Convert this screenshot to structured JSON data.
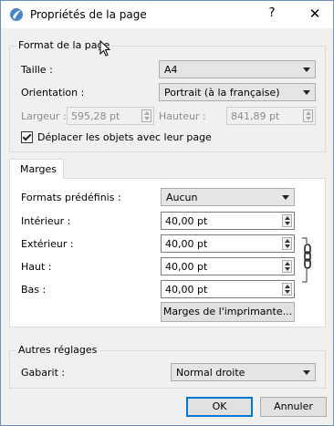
{
  "window": {
    "title": "Propriétés de la page",
    "help_label": "?",
    "close_label": "✕"
  },
  "page_format": {
    "group_title": "Format de la page",
    "size_label": "Taille :",
    "size_value": "A4",
    "orientation_label": "Orientation :",
    "orientation_value": "Portrait (à la française)",
    "width_label": "Largeur :",
    "width_value": "595,28 pt",
    "height_label": "Hauteur :",
    "height_value": "841,89 pt",
    "move_objects_label": "Déplacer les objets avec leur page",
    "move_objects_checked": true
  },
  "margins": {
    "tab_label": "Marges",
    "presets_label": "Formats prédéfinis :",
    "presets_value": "Aucun",
    "inside_label": "Intérieur :",
    "inside_value": "40,00 pt",
    "outside_label": "Extérieur :",
    "outside_value": "40,00 pt",
    "top_label": "Haut :",
    "top_value": "40,00 pt",
    "bottom_label": "Bas :",
    "bottom_value": "40,00 pt",
    "printer_margins_label": "Marges de l'imprimante..."
  },
  "other": {
    "group_title": "Autres réglages",
    "template_label": "Gabarit :",
    "template_value": "Normal droite"
  },
  "footer": {
    "ok_label": "OK",
    "cancel_label": "Annuler"
  },
  "colors": {
    "accent": "#0078d7",
    "dialog_bg": "#f0f0f0"
  }
}
